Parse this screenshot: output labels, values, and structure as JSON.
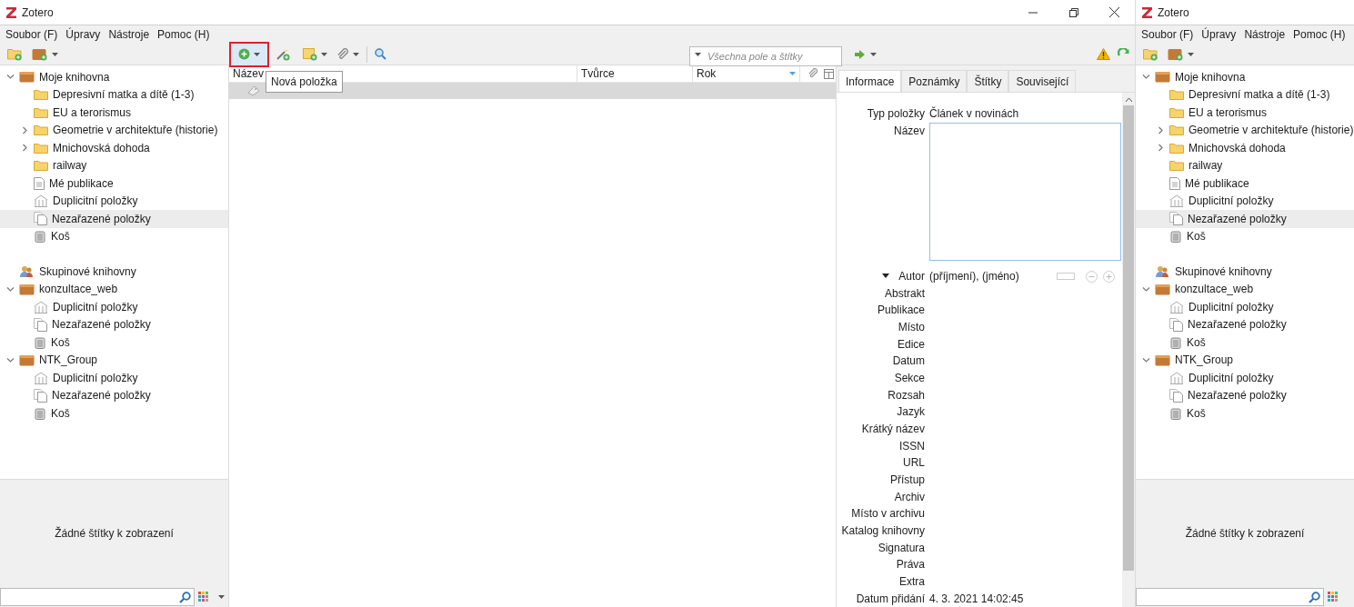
{
  "window": {
    "title": "Zotero",
    "menu": [
      "Soubor (F)",
      "Úpravy",
      "Nástroje",
      "Pomoc (H)"
    ],
    "toolbar": {
      "new_item": {
        "tooltip": "Nová položka",
        "highlighted": true
      },
      "search": {
        "placeholder": "Všechna pole a štítky"
      }
    },
    "collections": [
      {
        "kind": "library",
        "label": "Moje knihovna",
        "expanded": true,
        "selected": false,
        "children": [
          {
            "kind": "folder",
            "label": "Depresivní matka a dítě (1-3)",
            "selected": false
          },
          {
            "kind": "folder",
            "label": "EU a terorismus",
            "selected": false
          },
          {
            "kind": "folder",
            "label": "Geometrie v architektuře (historie)",
            "expanded": false,
            "selected": false
          },
          {
            "kind": "folder",
            "label": "Mnichovská dohoda",
            "expanded": false,
            "selected": false
          },
          {
            "kind": "folder",
            "label": "railway",
            "selected": false
          },
          {
            "kind": "publications",
            "label": "Mé publikace",
            "selected": false
          },
          {
            "kind": "duplicates",
            "label": "Duplicitní položky",
            "selected": false
          },
          {
            "kind": "unfiled",
            "label": "Nezařazené položky",
            "selected": true
          },
          {
            "kind": "trash",
            "label": "Koš",
            "selected": false
          }
        ]
      },
      {
        "kind": "groups",
        "label": "Skupinové knihovny",
        "selected": false
      },
      {
        "kind": "library",
        "label": "konzultace_web",
        "expanded": true,
        "selected": false,
        "children": [
          {
            "kind": "duplicates",
            "label": "Duplicitní položky",
            "selected": false
          },
          {
            "kind": "unfiled",
            "label": "Nezařazené položky",
            "selected": false
          },
          {
            "kind": "trash",
            "label": "Koš",
            "selected": false
          }
        ]
      },
      {
        "kind": "library",
        "label": "NTK_Group",
        "expanded": true,
        "selected": false,
        "children": [
          {
            "kind": "duplicates",
            "label": "Duplicitní položky",
            "selected": false
          },
          {
            "kind": "unfiled",
            "label": "Nezařazené položky",
            "selected": false
          },
          {
            "kind": "trash",
            "label": "Koš",
            "selected": false
          }
        ]
      }
    ],
    "tag_selector": {
      "empty_text": "Žádné štítky k zobrazení"
    },
    "items": {
      "columns": [
        "Název",
        "Tvůrce",
        "Rok"
      ],
      "rows": [
        {
          "selected": true
        }
      ]
    },
    "item_pane": {
      "tabs": [
        {
          "label": "Informace",
          "selected": true
        },
        {
          "label": "Poznámky",
          "selected": false
        },
        {
          "label": "Štítky",
          "selected": false
        },
        {
          "label": "Související",
          "selected": false
        }
      ],
      "fields": [
        {
          "kind": "text",
          "label": "Typ položky",
          "value": "Článek v novinách"
        },
        {
          "kind": "textarea",
          "label": "Název"
        },
        {
          "kind": "creator",
          "label": "Autor",
          "value": "(příjmení), (jméno)",
          "expanded": true
        },
        {
          "kind": "text",
          "label": "Abstrakt"
        },
        {
          "kind": "text",
          "label": "Publikace"
        },
        {
          "kind": "text",
          "label": "Místo"
        },
        {
          "kind": "text",
          "label": "Edice"
        },
        {
          "kind": "text",
          "label": "Datum"
        },
        {
          "kind": "text",
          "label": "Sekce"
        },
        {
          "kind": "text",
          "label": "Rozsah"
        },
        {
          "kind": "text",
          "label": "Jazyk"
        },
        {
          "kind": "text",
          "label": "Krátký název"
        },
        {
          "kind": "text",
          "label": "ISSN"
        },
        {
          "kind": "text",
          "label": "URL"
        },
        {
          "kind": "text",
          "label": "Přístup"
        },
        {
          "kind": "text",
          "label": "Archiv"
        },
        {
          "kind": "text",
          "label": "Místo v archivu"
        },
        {
          "kind": "text",
          "label": "Katalog knihovny"
        },
        {
          "kind": "text",
          "label": "Signatura"
        },
        {
          "kind": "text",
          "label": "Práva"
        },
        {
          "kind": "text",
          "label": "Extra"
        },
        {
          "kind": "text",
          "label": "Datum přidání",
          "value": "4. 3. 2021 14:02:45"
        }
      ]
    }
  },
  "second_window": {
    "title": "Zotero",
    "menu": [
      "Soubor (F)",
      "Úpravy",
      "Nástroje",
      "Pomoc (H)"
    ],
    "collections": [
      {
        "kind": "library",
        "label": "Moje knihovna",
        "expanded": true,
        "selected": false,
        "children": [
          {
            "kind": "folder",
            "label": "Depresivní matka a dítě (1-3)",
            "selected": false
          },
          {
            "kind": "folder",
            "label": "EU a terorismus",
            "selected": false
          },
          {
            "kind": "folder",
            "label": "Geometrie v architektuře (historie)",
            "expanded": false,
            "selected": false
          },
          {
            "kind": "folder",
            "label": "Mnichovská dohoda",
            "expanded": false,
            "selected": false
          },
          {
            "kind": "folder",
            "label": "railway",
            "selected": false
          },
          {
            "kind": "publications",
            "label": "Mé publikace",
            "selected": false
          },
          {
            "kind": "duplicates",
            "label": "Duplicitní položky",
            "selected": false
          },
          {
            "kind": "unfiled",
            "label": "Nezařazené položky",
            "selected": true
          },
          {
            "kind": "trash",
            "label": "Koš",
            "selected": false
          }
        ]
      },
      {
        "kind": "groups",
        "label": "Skupinové knihovny",
        "selected": false
      },
      {
        "kind": "library",
        "label": "konzultace_web",
        "expanded": true,
        "selected": false,
        "children": [
          {
            "kind": "duplicates",
            "label": "Duplicitní položky",
            "selected": false
          },
          {
            "kind": "unfiled",
            "label": "Nezařazené položky",
            "selected": false
          },
          {
            "kind": "trash",
            "label": "Koš",
            "selected": false
          }
        ]
      },
      {
        "kind": "library",
        "label": "NTK_Group",
        "expanded": true,
        "selected": false,
        "children": [
          {
            "kind": "duplicates",
            "label": "Duplicitní položky",
            "selected": false
          },
          {
            "kind": "unfiled",
            "label": "Nezařazené položky",
            "selected": false
          },
          {
            "kind": "trash",
            "label": "Koš",
            "selected": false
          }
        ]
      }
    ],
    "tag_selector": {
      "empty_text": "Žádné štítky k zobrazení"
    }
  }
}
